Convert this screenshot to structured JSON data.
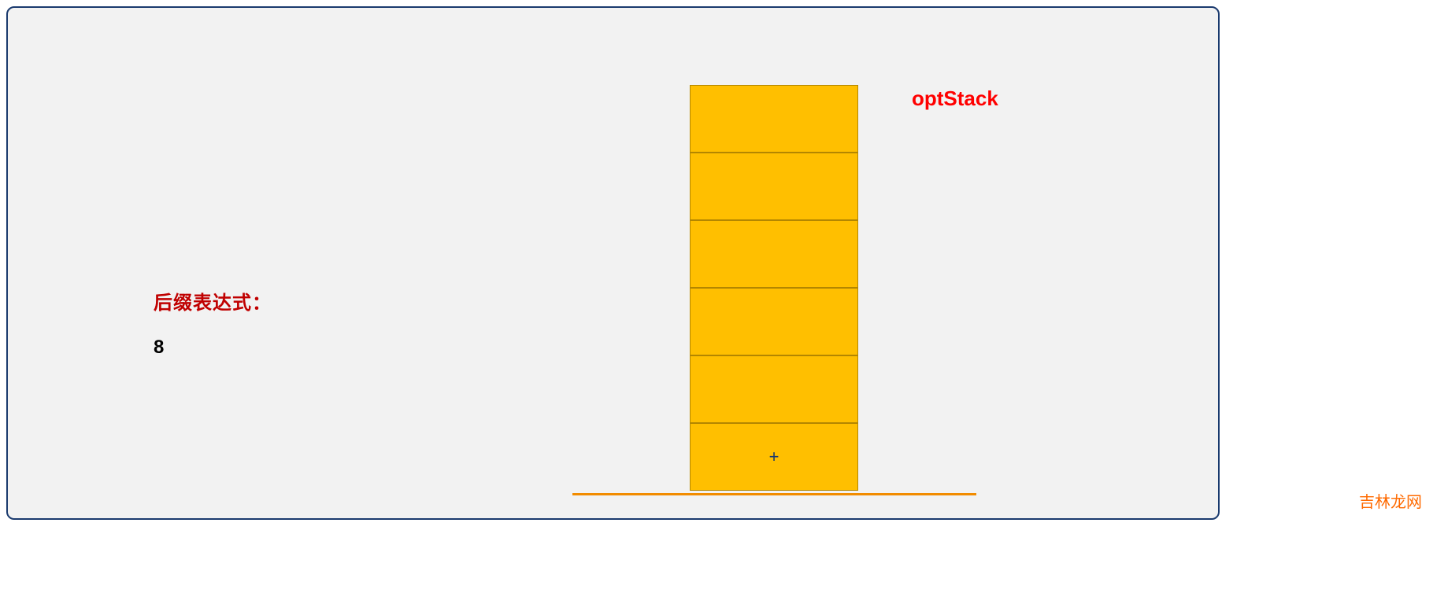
{
  "left": {
    "label": "后缀表达式：",
    "value": "8"
  },
  "stack": {
    "label": "optStack",
    "cells": [
      "",
      "",
      "",
      "",
      "",
      "+"
    ]
  },
  "watermark": "吉林龙网"
}
